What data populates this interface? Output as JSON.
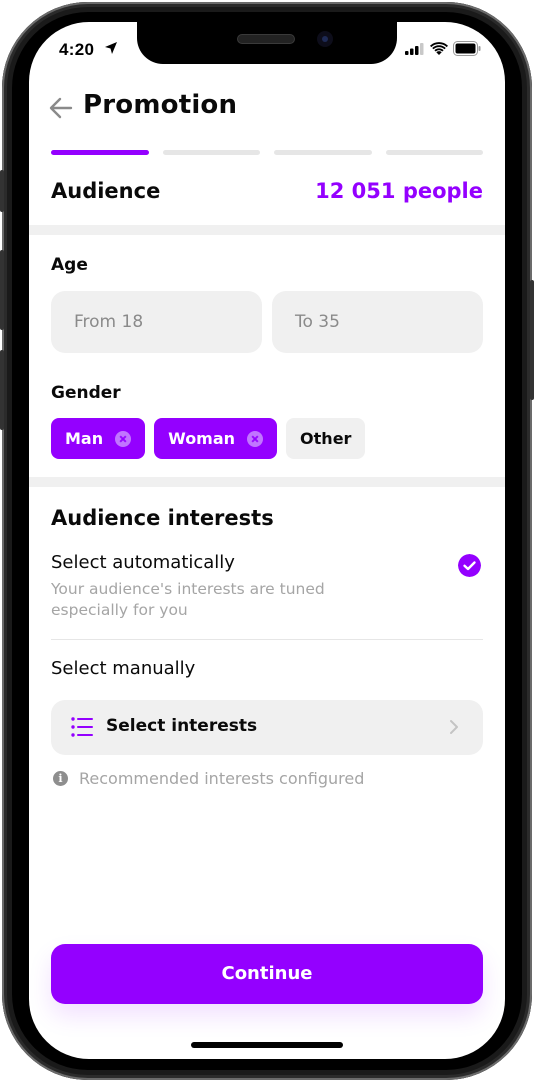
{
  "theme": {
    "accent": "#9400ff",
    "chip_x_bg": "#c176ff",
    "text_primary": "#0a0a0a",
    "text_secondary": "#a5a5a5"
  },
  "status_bar": {
    "time": "4:20",
    "location_icon": "location-arrow-icon",
    "signal_icon": "cellular-signal-icon",
    "wifi_icon": "wifi-icon",
    "battery_icon": "battery-icon"
  },
  "header": {
    "back_icon": "arrow-left-icon",
    "title": "Promotion"
  },
  "progress": {
    "total_steps": 4,
    "current_step": 1
  },
  "audience": {
    "label": "Audience",
    "count": "12 051 people"
  },
  "age": {
    "label": "Age",
    "from_placeholder": "From 18",
    "to_placeholder": "To 35"
  },
  "gender": {
    "label": "Gender",
    "options": [
      {
        "label": "Man",
        "selected": true
      },
      {
        "label": "Woman",
        "selected": true
      },
      {
        "label": "Other",
        "selected": false
      }
    ]
  },
  "interests": {
    "title": "Audience interests",
    "auto": {
      "title": "Select automatically",
      "description": "Your audience's interests are tuned especially for you",
      "checked": true
    },
    "manual": {
      "title": "Select manually",
      "button_label": "Select interests",
      "button_icon": "list-icon",
      "chevron_icon": "chevron-right-icon"
    },
    "info": {
      "icon": "info-icon",
      "text": "Recommended interests configured"
    }
  },
  "footer": {
    "continue_label": "Continue"
  }
}
